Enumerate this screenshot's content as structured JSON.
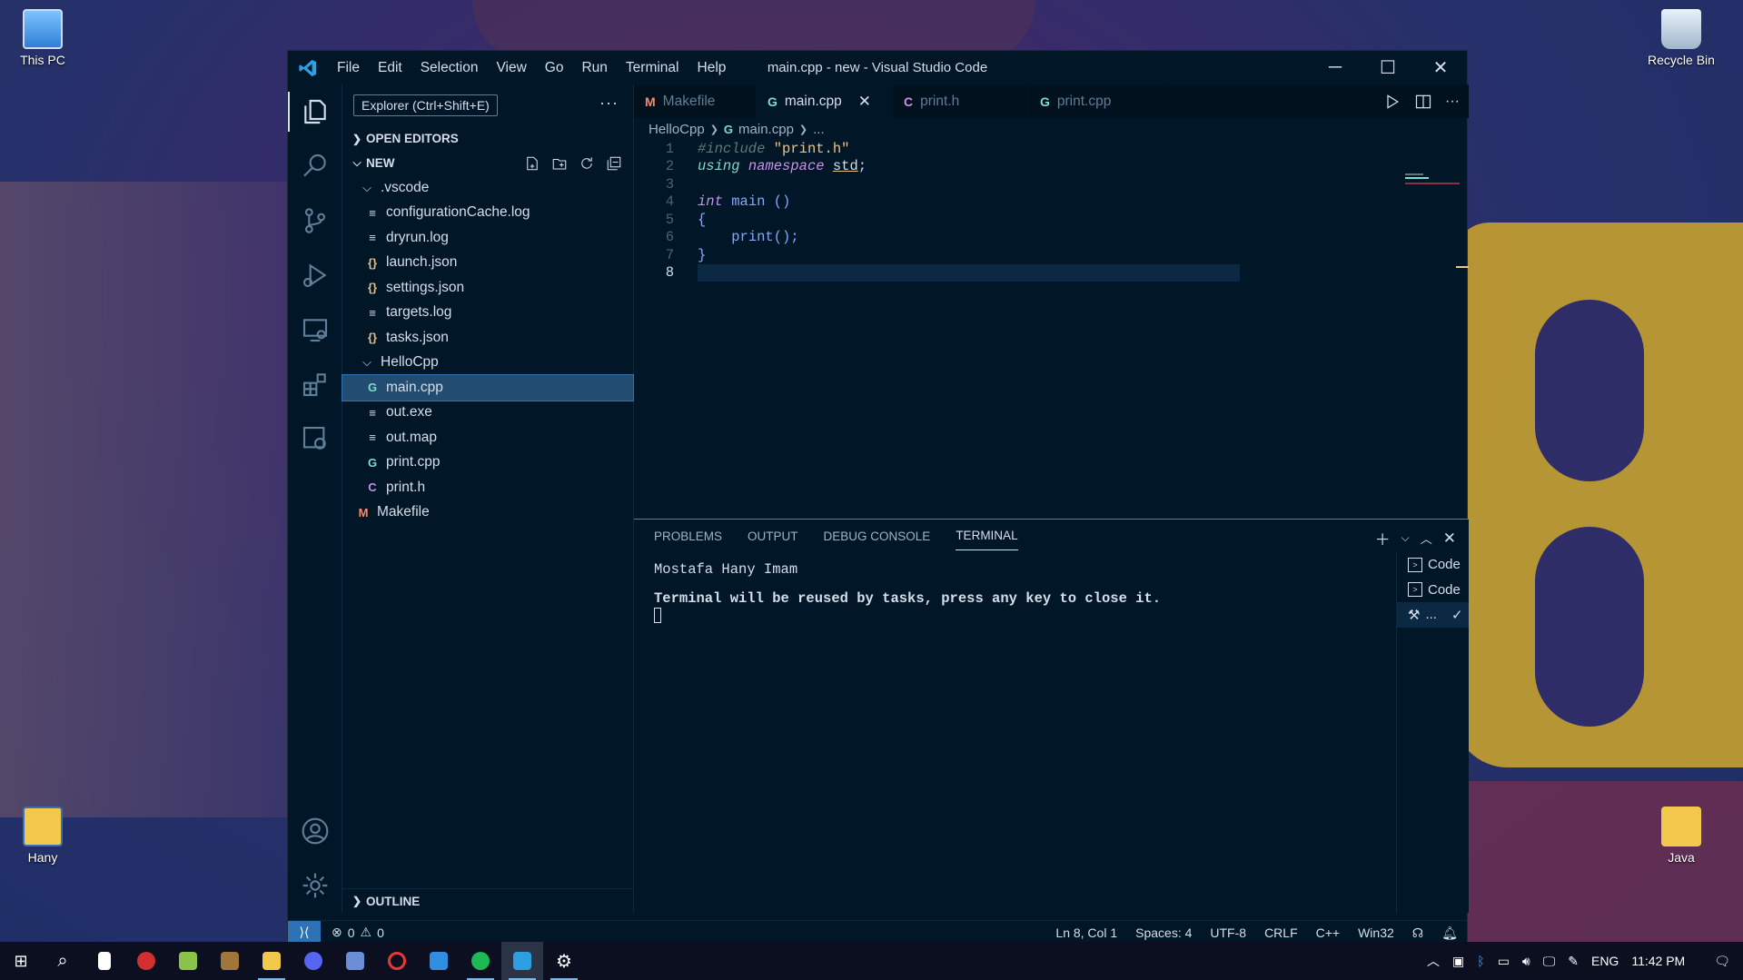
{
  "desktop": {
    "icons": [
      {
        "label": "This PC"
      },
      {
        "label": "Recycle Bin"
      },
      {
        "label": "Hany"
      },
      {
        "label": "Java"
      }
    ]
  },
  "window": {
    "title": "main.cpp - new - Visual Studio Code",
    "menu": [
      "File",
      "Edit",
      "Selection",
      "View",
      "Go",
      "Run",
      "Terminal",
      "Help"
    ]
  },
  "sidebar": {
    "tooltip": "Explorer (Ctrl+Shift+E)",
    "open_editors": "OPEN EDITORS",
    "folder": "NEW",
    "outline": "OUTLINE",
    "items": [
      {
        "label": ".vscode",
        "kind": "folder"
      },
      {
        "label": "configurationCache.log",
        "kind": "file"
      },
      {
        "label": "dryrun.log",
        "kind": "file"
      },
      {
        "label": "launch.json",
        "kind": "json"
      },
      {
        "label": "settings.json",
        "kind": "json"
      },
      {
        "label": "targets.log",
        "kind": "file"
      },
      {
        "label": "tasks.json",
        "kind": "json"
      },
      {
        "label": "HelloCpp",
        "kind": "folder"
      },
      {
        "label": "main.cpp",
        "kind": "cpp"
      },
      {
        "label": "out.exe",
        "kind": "file"
      },
      {
        "label": "out.map",
        "kind": "file"
      },
      {
        "label": "print.cpp",
        "kind": "cpp"
      },
      {
        "label": "print.h",
        "kind": "h"
      },
      {
        "label": "Makefile",
        "kind": "m"
      }
    ]
  },
  "tabs": [
    {
      "label": "Makefile",
      "icon": "M"
    },
    {
      "label": "main.cpp",
      "icon": "C++"
    },
    {
      "label": "print.h",
      "icon": "C"
    },
    {
      "label": "print.cpp",
      "icon": "C++"
    }
  ],
  "breadcrumb": {
    "folder": "HelloCpp",
    "file": "main.cpp",
    "more": "..."
  },
  "code": {
    "line_numbers": [
      "1",
      "2",
      "3",
      "4",
      "5",
      "6",
      "7",
      "8"
    ],
    "l1_dir": "#include",
    "l1_str": "\"print.h\"",
    "l2_using": "using",
    "l2_ns": "namespace",
    "l2_std": "std",
    "l2_semi": ";",
    "l4_type": "int",
    "l4_fn": "main",
    "l4_paren": "()",
    "l5": "{",
    "l6_fn": "print",
    "l6_rest": "();",
    "l7": "}"
  },
  "panel": {
    "tabs": [
      "PROBLEMS",
      "OUTPUT",
      "DEBUG CONSOLE",
      "TERMINAL"
    ],
    "terminal_line1": "Mostafa Hany Imam",
    "terminal_line2": "Terminal will be reused by tasks, press any key to close it.",
    "terminals": [
      "Code",
      "Code",
      "..."
    ]
  },
  "status": {
    "errors": "0",
    "warnings": "0",
    "position": "Ln 8, Col 1",
    "spaces": "Spaces: 4",
    "encoding": "UTF-8",
    "eol": "CRLF",
    "language": "C++",
    "platform": "Win32"
  },
  "taskbar": {
    "lang": "ENG",
    "time": "11:42 PM"
  },
  "colors": {
    "accent": "#2d72b5",
    "bg": "#011627"
  }
}
